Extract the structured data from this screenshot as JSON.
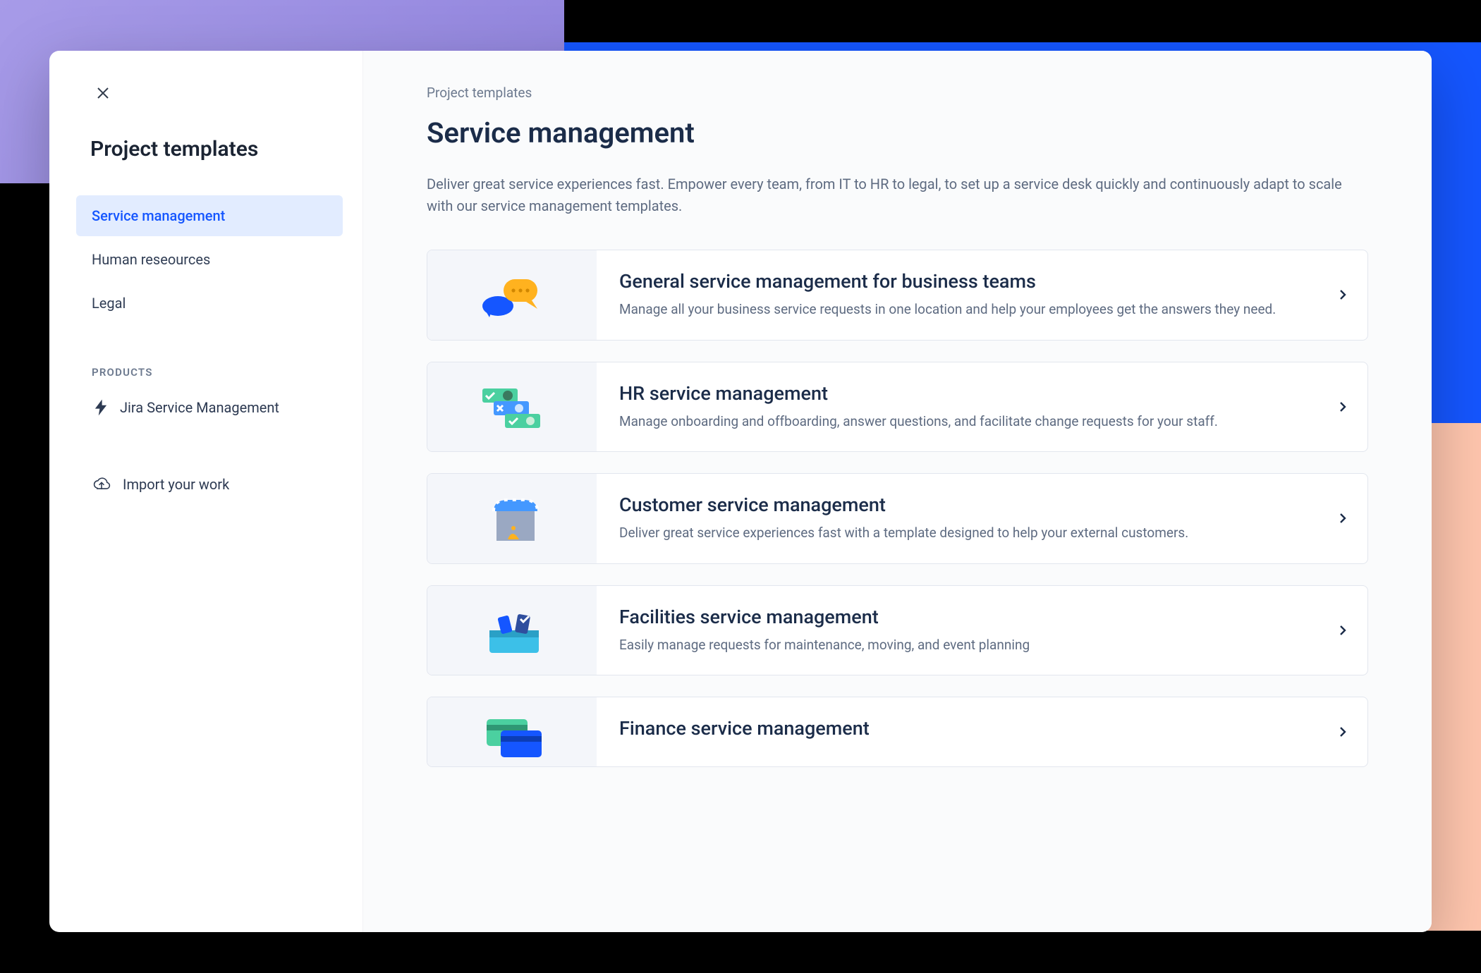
{
  "sidebar": {
    "title": "Project templates",
    "items": [
      {
        "label": "Service management",
        "active": true
      },
      {
        "label": "Human reseources",
        "active": false
      },
      {
        "label": "Legal",
        "active": false
      }
    ],
    "products_label": "PRODUCTS",
    "products": [
      {
        "label": "Jira Service Management",
        "icon": "jsm-bolt-icon"
      }
    ],
    "import_label": "Import your work"
  },
  "main": {
    "breadcrumb": "Project templates",
    "title": "Service management",
    "description": "Deliver great service experiences fast. Empower every team, from IT to HR to legal, to set up a service desk quickly and continuously adapt to scale with our service management templates.",
    "templates": [
      {
        "title": "General service management for business teams",
        "description": "Manage all your business service requests in one location and help your employees get the answers they need.",
        "icon": "chat-bubbles-icon"
      },
      {
        "title": "HR service management",
        "description": "Manage onboarding and offboarding, answer questions, and facilitate change requests for your staff.",
        "icon": "hr-cards-icon"
      },
      {
        "title": "Customer service management",
        "description": "Deliver great service experiences fast with a template designed to help your external customers.",
        "icon": "storefront-icon"
      },
      {
        "title": "Facilities service management",
        "description": "Easily manage requests for maintenance, moving, and event planning",
        "icon": "toolbox-icon"
      },
      {
        "title": "Finance service management",
        "description": "",
        "icon": "credit-cards-icon"
      }
    ]
  }
}
